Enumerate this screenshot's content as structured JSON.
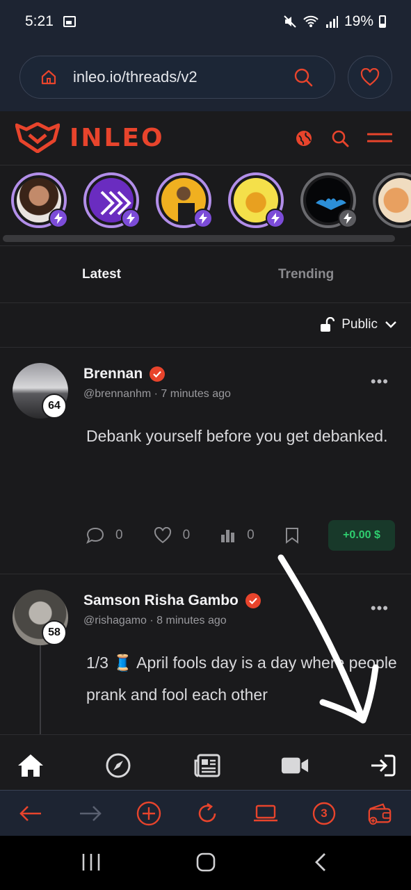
{
  "status_bar": {
    "time": "5:21",
    "battery": "19%"
  },
  "browser": {
    "url": "inleo.io/threads/v2"
  },
  "site": {
    "brand": "INLEO",
    "brand_color": "#e8442c"
  },
  "tabs": {
    "latest": "Latest",
    "trending": "Trending"
  },
  "visibility": {
    "label": "Public"
  },
  "posts": [
    {
      "name": "Brennan",
      "reputation": "64",
      "meta": "@brennanhm · 7 minutes ago",
      "text": "Debank yourself before you get debanked.",
      "comments": "0",
      "likes": "0",
      "views": "0",
      "tip": "+0.00 $"
    },
    {
      "name": "Samson Risha Gambo",
      "reputation": "58",
      "meta": "@rishagamo · 8 minutes ago",
      "text": "1/3 🧵 April fools day is a day where people prank and fool each other"
    }
  ],
  "browser_bar": {
    "tabs_count": "3"
  },
  "colors": {
    "accent": "#e8442c",
    "story_ring": "#b28ee9",
    "tip_green": "#2fcf6f"
  }
}
